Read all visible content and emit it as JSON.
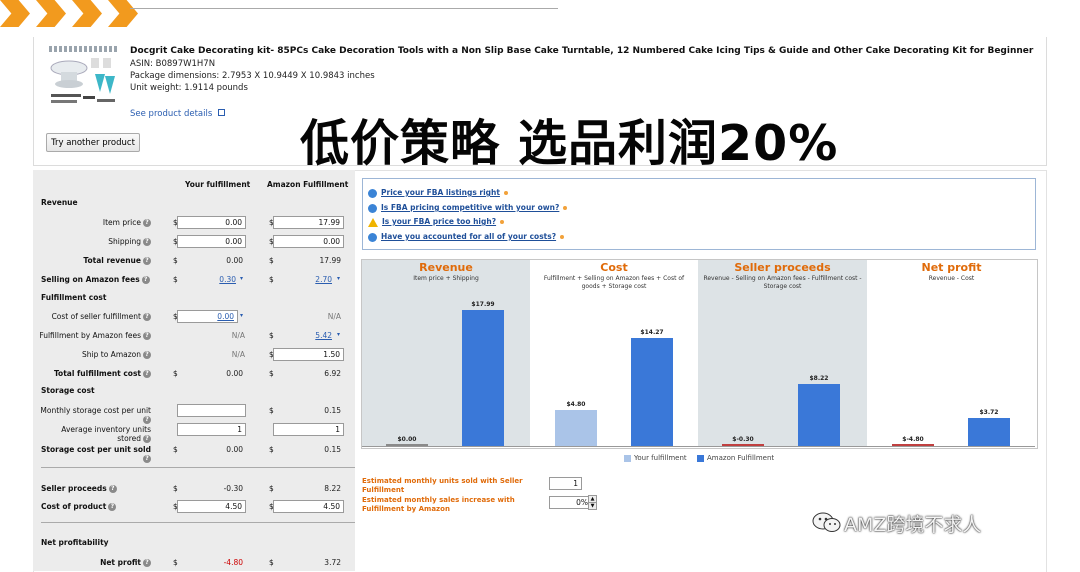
{
  "product": {
    "title": "Docgrit Cake Decorating kit- 85PCs Cake Decoration Tools with a Non Slip Base Cake Turntable, 12 Numbered Cake Icing Tips & Guide and Other Cake Decorating Kit for Beginner",
    "asin": "ASIN: B0897W1H7N",
    "dimensions": "Package dimensions: 2.7953 X 10.9449 X 10.9843 inches",
    "weight": "Unit weight: 1.9114 pounds",
    "details_link": "See product details",
    "try_button": "Try another product"
  },
  "overlay_text": "低价策略  选品利润20%",
  "calculator": {
    "col_your": "Your fulfillment",
    "col_amazon": "Amazon Fulfillment",
    "currency": "$",
    "revenue_section": "Revenue",
    "item_price": {
      "label": "Item price",
      "your": "0.00",
      "amazon": "17.99"
    },
    "shipping": {
      "label": "Shipping",
      "your": "0.00",
      "amazon": "0.00"
    },
    "total_revenue": {
      "label": "Total revenue",
      "your": "0.00",
      "amazon": "17.99"
    },
    "selling_fees": {
      "label": "Selling on Amazon fees",
      "your": "0.30",
      "amazon": "2.70"
    },
    "fulfillment_section": "Fulfillment cost",
    "seller_fulfillment": {
      "label": "Cost of seller fulfillment",
      "your": "0.00",
      "amazon": "N/A"
    },
    "fba_fees": {
      "label": "Fulfillment by Amazon fees",
      "your": "N/A",
      "amazon": "5.42"
    },
    "ship_to_amazon": {
      "label": "Ship to Amazon",
      "your": "N/A",
      "amazon": "1.50"
    },
    "total_fulfillment": {
      "label": "Total fulfillment cost",
      "your": "0.00",
      "amazon": "6.92"
    },
    "storage_section": "Storage cost",
    "monthly_storage": {
      "label": "Monthly storage cost per unit",
      "your": "",
      "amazon": "0.15"
    },
    "avg_inventory": {
      "label": "Average inventory units stored",
      "your": "1",
      "amazon": "1"
    },
    "storage_per_unit": {
      "label": "Storage cost per unit sold",
      "your": "0.00",
      "amazon": "0.15"
    },
    "seller_proceeds": {
      "label": "Seller proceeds",
      "your": "-0.30",
      "amazon": "8.22"
    },
    "cost_of_product": {
      "label": "Cost of product",
      "your": "4.50",
      "amazon": "4.50"
    },
    "profit_section": "Net profitability",
    "net_profit": {
      "label": "Net profit",
      "your": "-4.80",
      "amazon": "3.72"
    }
  },
  "tips": [
    "Price your FBA listings right",
    "Is FBA pricing competitive with your own?",
    "Is your FBA price too high?",
    "Have you accounted for all of your costs?"
  ],
  "chart_data": {
    "type": "bar",
    "categories": [
      "Revenue",
      "Cost",
      "Seller proceeds",
      "Net profit"
    ],
    "subtitles": [
      "Item price + Shipping",
      "Fulfillment + Selling on Amazon fees + Cost of goods + Storage cost",
      "Revenue - Selling on Amazon fees - Fulfillment cost - Storage cost",
      "Revenue - Cost"
    ],
    "series": [
      {
        "name": "Your fulfillment",
        "values": [
          0.0,
          4.8,
          -0.3,
          -4.8
        ],
        "labels": [
          "$0.00",
          "$4.80",
          "$-0.30",
          "$-4.80"
        ],
        "color": "#aac4e8"
      },
      {
        "name": "Amazon Fulfillment",
        "values": [
          17.99,
          14.27,
          8.22,
          3.72
        ],
        "labels": [
          "$17.99",
          "$14.27",
          "$8.22",
          "$3.72"
        ],
        "color": "#3a78d8"
      }
    ],
    "legend": "bottom"
  },
  "estimates": {
    "units_label": "Estimated monthly units sold with Seller Fulfillment",
    "units_value": "1",
    "increase_label": "Estimated monthly sales increase with Fulfillment by Amazon",
    "increase_value": "0",
    "increase_unit": "%"
  },
  "watermark": "AMZ跨境不求人",
  "colors": {
    "accent": "#f29a1e",
    "title_orange": "#e06b0a",
    "link_blue": "#2a5db0",
    "bar_light": "#aac4e8",
    "bar_dark": "#3a78d8"
  }
}
